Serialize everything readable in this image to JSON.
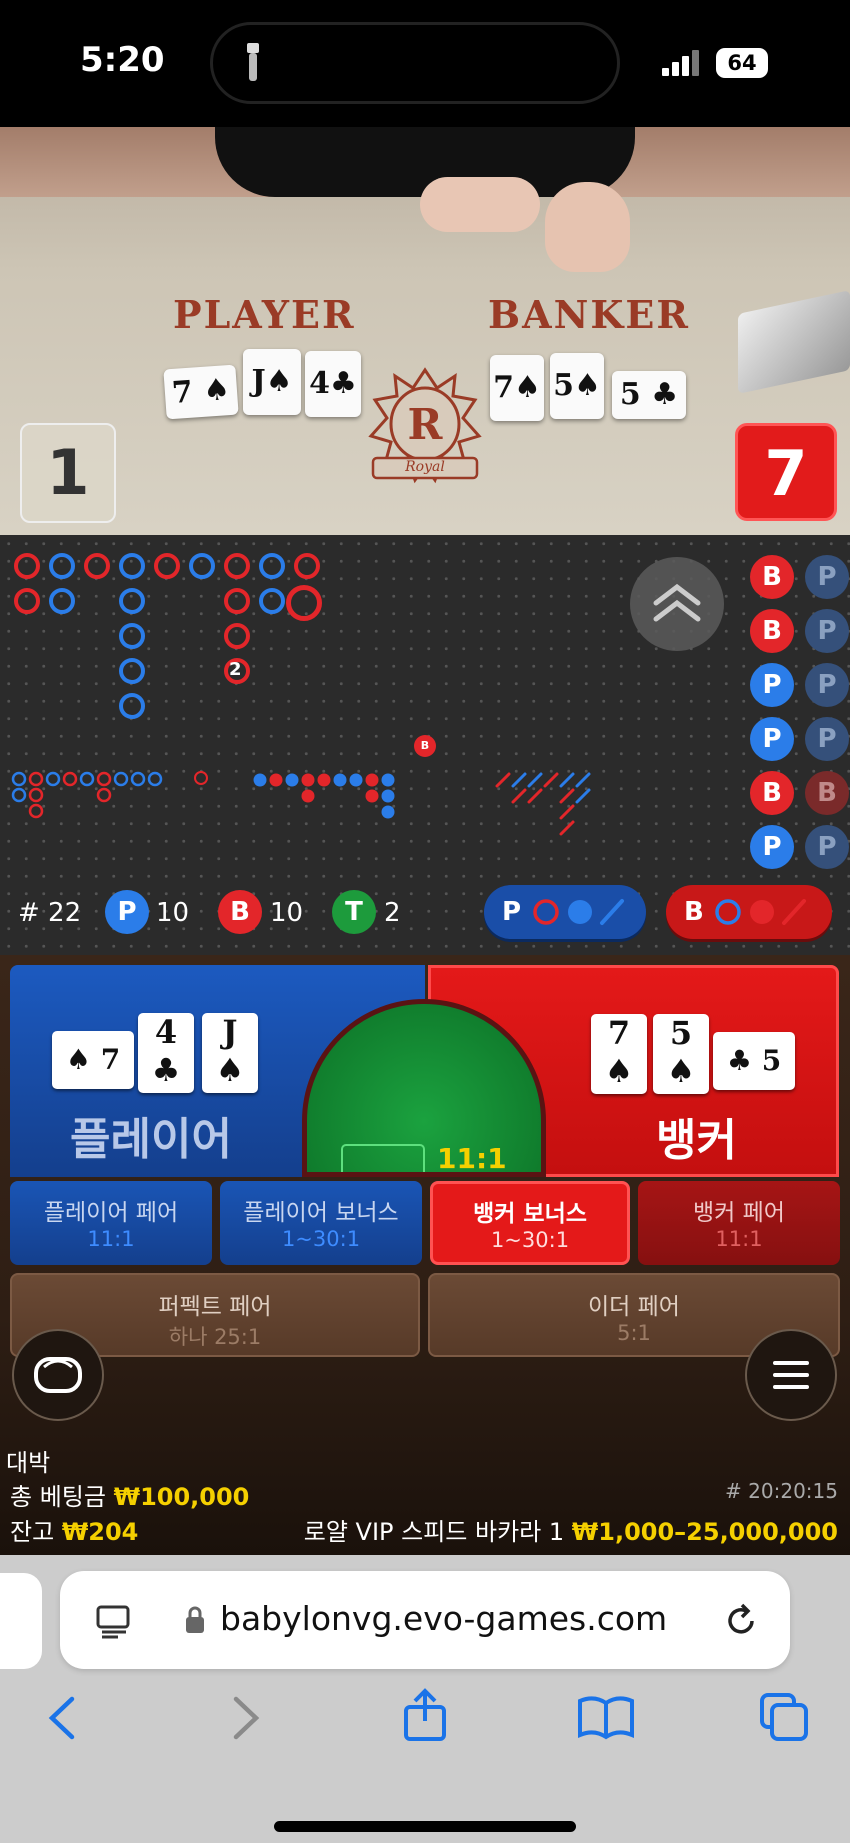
{
  "status_bar": {
    "time": "5:20",
    "battery": "64"
  },
  "video": {
    "player_label": "PLAYER",
    "banker_label": "BANKER",
    "player_score": "1",
    "banker_score": "7",
    "player_cards": [
      "7",
      "J",
      "4"
    ],
    "banker_cards": [
      "7",
      "5",
      "5"
    ],
    "logo_letter": "R",
    "logo_text": "Royal"
  },
  "stats": {
    "round": "# 22",
    "player_count": "10",
    "banker_count": "10",
    "tie_count": "2",
    "player_letter": "P",
    "banker_letter": "B",
    "tie_letter": "T",
    "bead_marker": "2",
    "bead_b_marker": "B"
  },
  "predict": {
    "player_label": "P",
    "banker_label": "B"
  },
  "bead_road": [
    "B",
    "B",
    "P",
    "P",
    "B",
    "P"
  ],
  "bead_road_partial": [
    "P",
    "P",
    "P",
    "P",
    "B",
    "P"
  ],
  "betting": {
    "player_label": "플레이어",
    "banker_label": "뱅커",
    "tie_odds": "11:1",
    "player_cards": [
      {
        "rank": "7",
        "suit": "♠"
      },
      {
        "rank": "4",
        "suit": "♣"
      },
      {
        "rank": "J",
        "suit": "♠"
      }
    ],
    "banker_cards": [
      {
        "rank": "7",
        "suit": "♠"
      },
      {
        "rank": "5",
        "suit": "♠"
      },
      {
        "rank": "5",
        "suit": "♣"
      }
    ],
    "side_bets": [
      {
        "label": "플레이어 페어",
        "odds": "11:1"
      },
      {
        "label": "플레이어 보너스",
        "odds": "1~30:1"
      },
      {
        "label": "뱅커 보너스",
        "odds": "1~30:1"
      },
      {
        "label": "뱅커 페어",
        "odds": "11:1"
      }
    ],
    "perfect_pair": {
      "label": "퍼펙트 페어",
      "odds": "하나 25:1"
    },
    "either_pair": {
      "label": "이더 페어",
      "odds": "5:1"
    }
  },
  "info": {
    "status_msg": "대박",
    "total_bet_label": "총 베팅금",
    "total_bet_value": "₩100,000",
    "balance_label": "잔고",
    "balance_value": "₩204",
    "game_id": "# 20:20:15",
    "table_name": "로얄 VIP 스피드 바카라 1",
    "limits": "₩1,000–25,000,000"
  },
  "safari": {
    "url": "babylonvg.evo-games.com"
  },
  "colors": {
    "player_blue": "#1f6fe5",
    "banker_red": "#e21b1b",
    "tie_green": "#1d9b3c",
    "gold": "#f5d000"
  }
}
